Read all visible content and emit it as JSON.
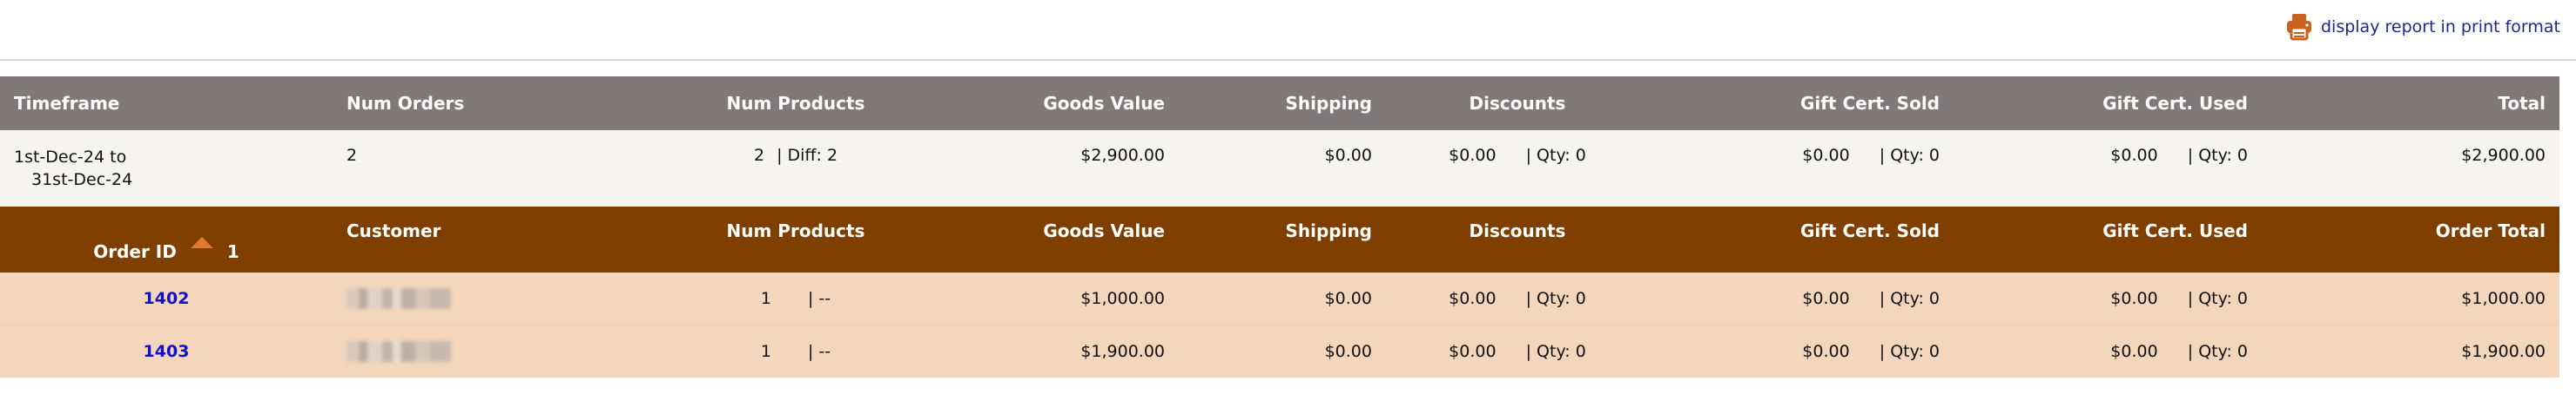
{
  "print_link": {
    "label": "display report in print format",
    "icon": "printer-icon"
  },
  "summary_table": {
    "headers": {
      "timeframe": "Timeframe",
      "num_orders": "Num Orders",
      "num_products": "Num Products",
      "goods_value": "Goods Value",
      "shipping": "Shipping",
      "discounts": "Discounts",
      "gift_cert_sold": "Gift Cert. Sold",
      "gift_cert_used": "Gift Cert. Used",
      "total": "Total"
    },
    "row": {
      "timeframe_line1": "1st-Dec-24 to",
      "timeframe_line2": "31st-Dec-24",
      "num_orders": "2",
      "num_products": "2",
      "num_products_diff": "| Diff: 2",
      "goods_value": "$2,900.00",
      "shipping": "$0.00",
      "discounts": "$0.00",
      "discounts_qty": "| Qty: 0",
      "gift_cert_sold": "$0.00",
      "gift_cert_sold_qty": "| Qty: 0",
      "gift_cert_used": "$0.00",
      "gift_cert_used_qty": "| Qty: 0",
      "total": "$2,900.00"
    }
  },
  "orders_table": {
    "headers": {
      "order_id": "Order ID",
      "order_id_count": "1",
      "customer": "Customer",
      "num_products": "Num Products",
      "goods_value": "Goods Value",
      "shipping": "Shipping",
      "discounts": "Discounts",
      "gift_cert_sold": "Gift Cert. Sold",
      "gift_cert_used": "Gift Cert. Used",
      "order_total": "Order Total"
    },
    "rows": [
      {
        "order_id": "1402",
        "num_products": "1",
        "num_products_diff": "| --",
        "goods_value": "$1,000.00",
        "shipping": "$0.00",
        "discounts": "$0.00",
        "discounts_qty": "| Qty: 0",
        "gift_cert_sold": "$0.00",
        "gift_cert_sold_qty": "| Qty: 0",
        "gift_cert_used": "$0.00",
        "gift_cert_used_qty": "| Qty: 0",
        "order_total": "$1,000.00"
      },
      {
        "order_id": "1403",
        "num_products": "1",
        "num_products_diff": "| --",
        "goods_value": "$1,900.00",
        "shipping": "$0.00",
        "discounts": "$0.00",
        "discounts_qty": "| Qty: 0",
        "gift_cert_sold": "$0.00",
        "gift_cert_sold_qty": "| Qty: 0",
        "gift_cert_used": "$0.00",
        "gift_cert_used_qty": "| Qty: 0",
        "order_total": "$1,900.00"
      }
    ]
  },
  "colors": {
    "grey_header": "#7f7979",
    "summary_row": "#f5f4f0",
    "brown_header": "#7e3f00",
    "order_row": "#f4d6bc",
    "link": "#1010c8",
    "print_icon": "#c8621e"
  }
}
